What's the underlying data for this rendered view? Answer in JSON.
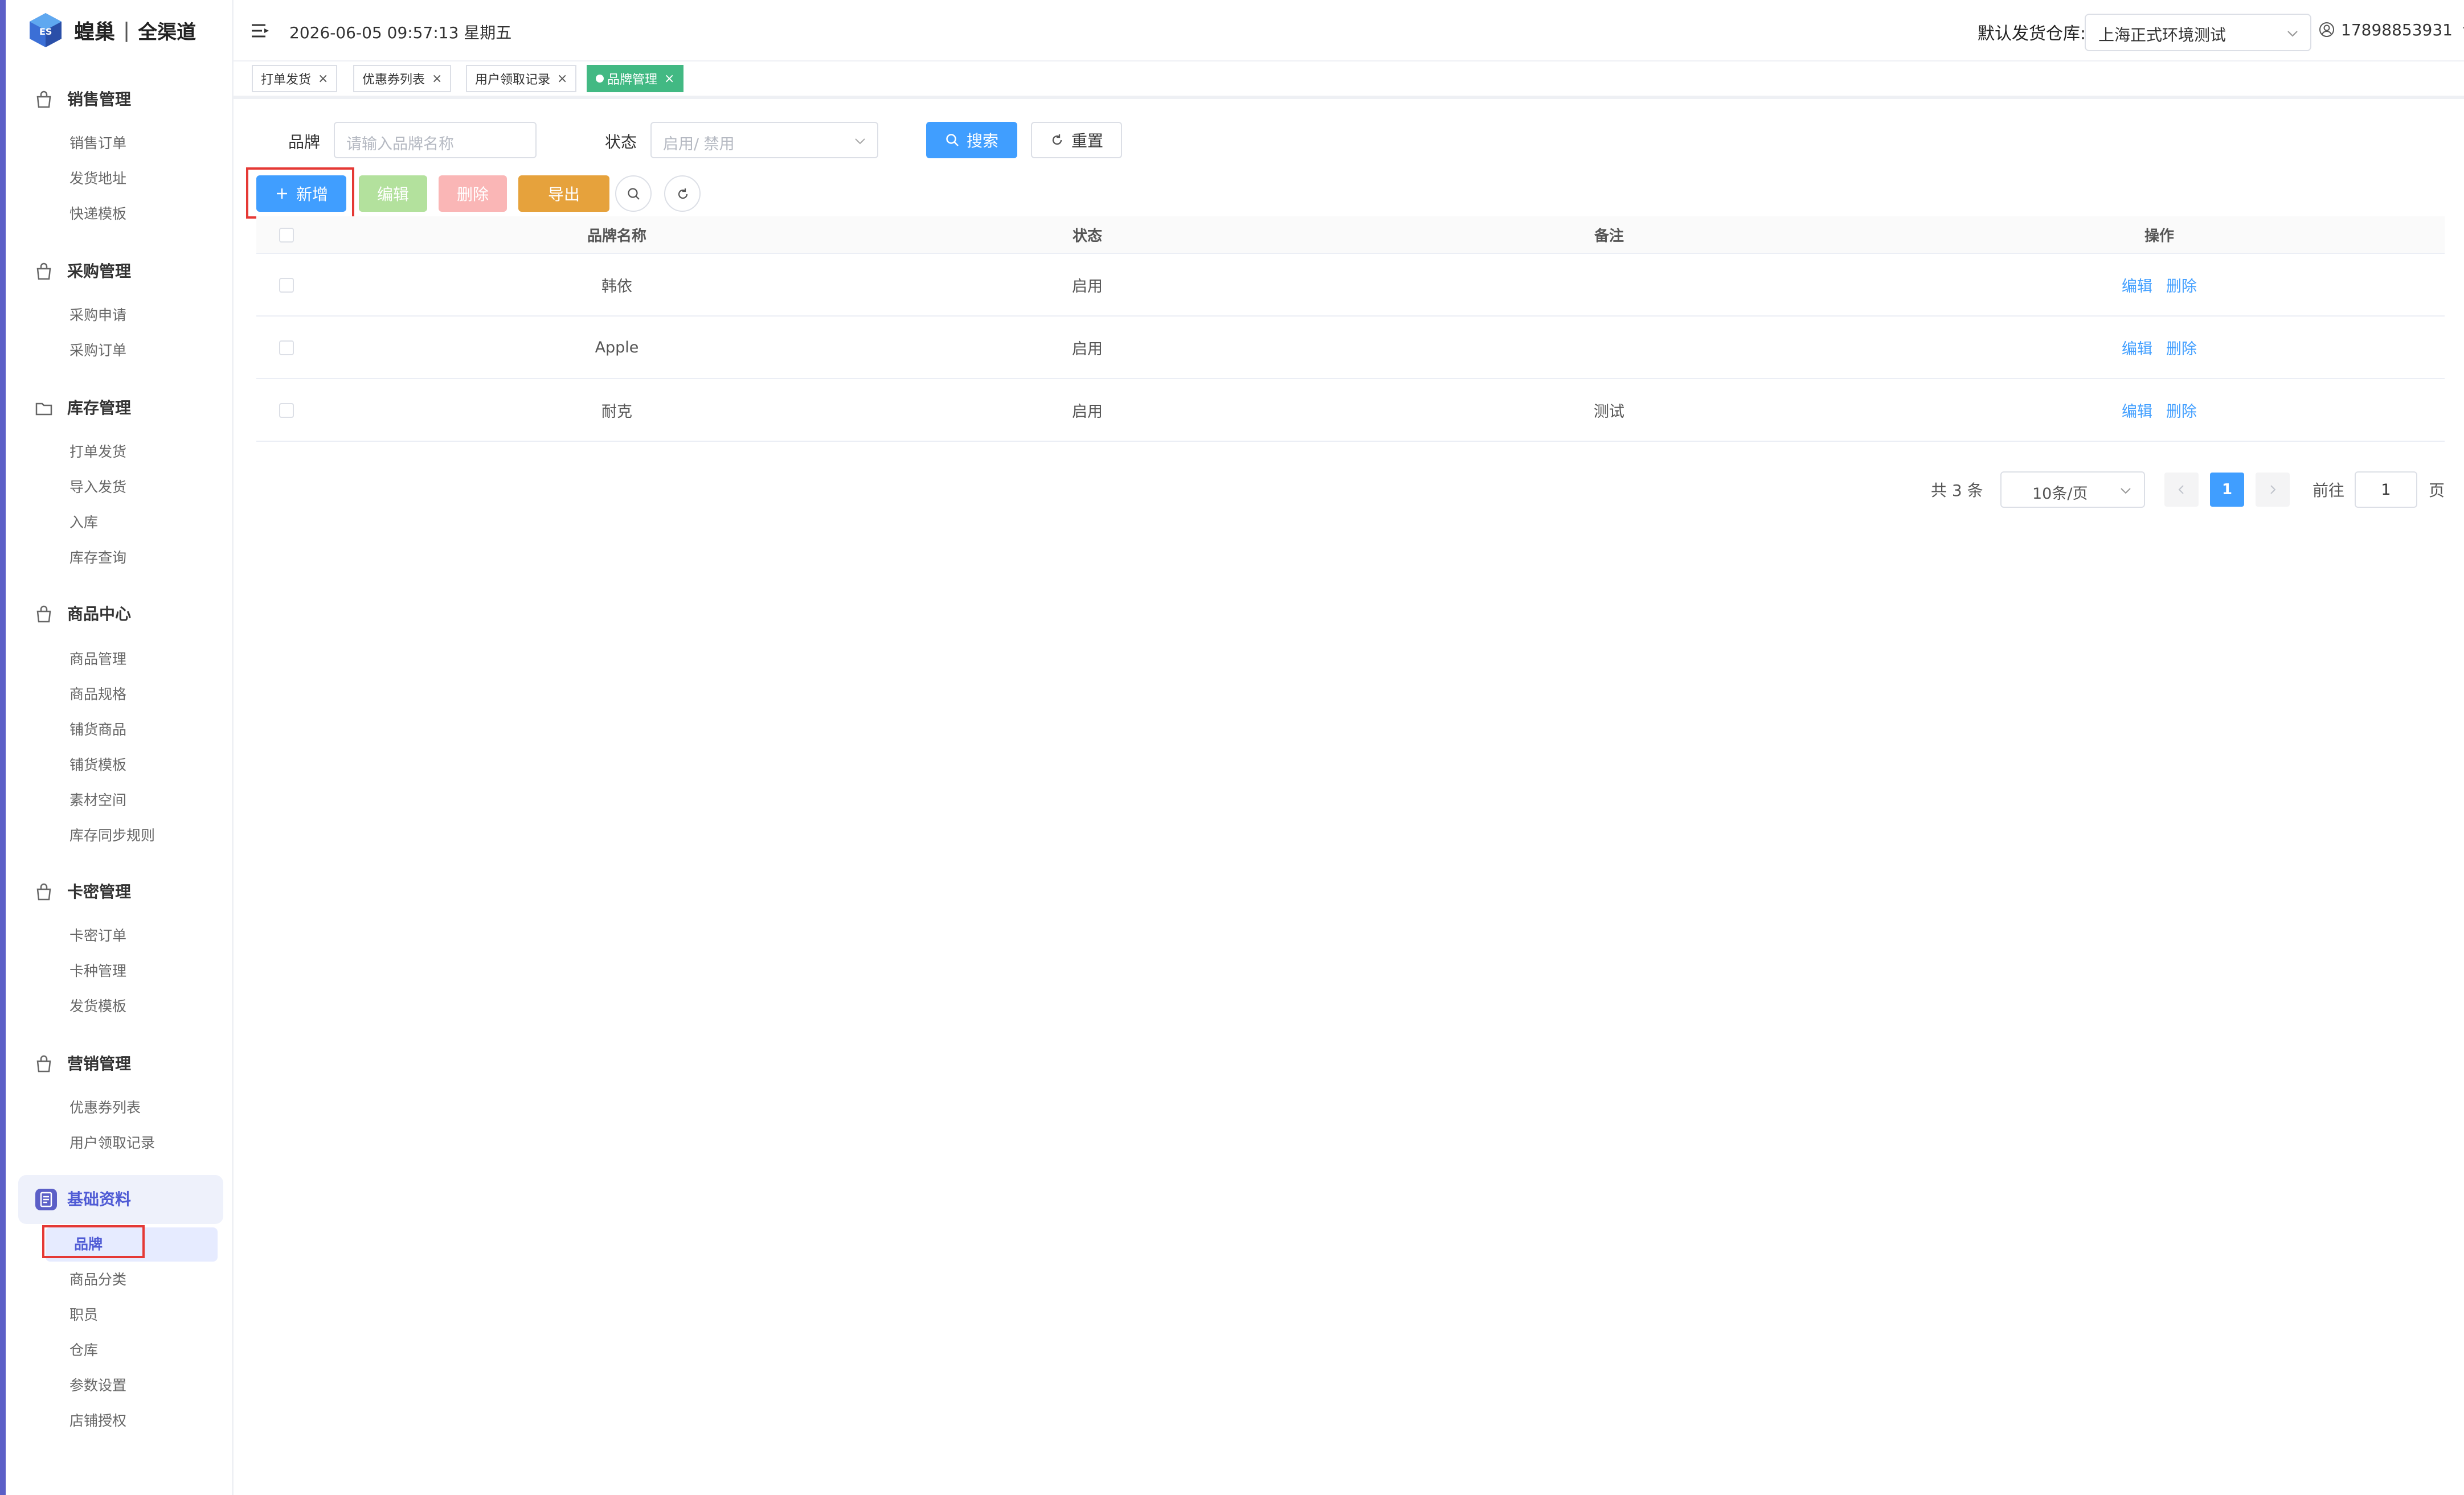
{
  "app": {
    "brand": "蝗巢",
    "separator": "|",
    "sub": "全渠道"
  },
  "header": {
    "datetime": "2026-06-05 09:57:13 星期五",
    "warehouse_label": "默认发货仓库:",
    "warehouse_value": "上海正式环境测试",
    "user": "17898853931"
  },
  "sidebar": {
    "groups": [
      {
        "label": "销售管理",
        "items": [
          "销售订单",
          "发货地址",
          "快递模板"
        ]
      },
      {
        "label": "采购管理",
        "items": [
          "采购申请",
          "采购订单"
        ]
      },
      {
        "label": "库存管理",
        "items": [
          "打单发货",
          "导入发货",
          "入库",
          "库存查询"
        ]
      },
      {
        "label": "商品中心",
        "items": [
          "商品管理",
          "商品规格",
          "铺货商品",
          "铺货模板",
          "素材空间",
          "库存同步规则"
        ]
      },
      {
        "label": "卡密管理",
        "items": [
          "卡密订单",
          "卡种管理",
          "发货模板"
        ]
      },
      {
        "label": "营销管理",
        "items": [
          "优惠券列表",
          "用户领取记录"
        ]
      },
      {
        "label": "基础资料",
        "items": [
          "品牌",
          "商品分类",
          "职员",
          "仓库",
          "参数设置",
          "店铺授权"
        ]
      }
    ],
    "active_group": "基础资料",
    "active_item": "品牌"
  },
  "tabs": [
    {
      "label": "打单发货",
      "close": "×"
    },
    {
      "label": "优惠券列表",
      "close": "×"
    },
    {
      "label": "用户领取记录",
      "close": "×"
    },
    {
      "label": "品牌管理",
      "close": "×",
      "active": true
    }
  ],
  "filters": {
    "brand_label": "品牌",
    "brand_placeholder": "请输入品牌名称",
    "status_label": "状态",
    "status_placeholder": "启用/ 禁用",
    "search_label": "搜索",
    "reset_label": "重置"
  },
  "toolbar": {
    "add_label": "新增",
    "edit_label": "编辑",
    "delete_label": "删除",
    "export_label": "导出"
  },
  "table": {
    "columns": [
      "品牌名称",
      "状态",
      "备注",
      "操作"
    ],
    "rows": [
      {
        "name": "韩依",
        "status": "启用",
        "note": "",
        "edit": "编辑",
        "delete": "删除"
      },
      {
        "name": "Apple",
        "status": "启用",
        "note": "",
        "edit": "编辑",
        "delete": "删除"
      },
      {
        "name": "耐克",
        "status": "启用",
        "note": "测试",
        "edit": "编辑",
        "delete": "删除"
      }
    ]
  },
  "pagination": {
    "total": "共 3 条",
    "page_size": "10条/页",
    "current": "1",
    "goto_label": "前往",
    "goto_value": "1",
    "page_suffix": "页"
  },
  "colors": {
    "primary": "#409eff",
    "success": "#42b983",
    "brand": "#5b5fc7",
    "edit_disabled": "#b3e19d",
    "delete_disabled": "#fab6b6",
    "export": "#e6a23c",
    "highlight": "#e53935"
  },
  "icons": {
    "logo": "cube-logo-icon",
    "menu": "hamburger-menu-icon",
    "user": "user-circle-icon",
    "search": "search-icon",
    "reset": "refresh-icon",
    "add": "plus-icon"
  }
}
